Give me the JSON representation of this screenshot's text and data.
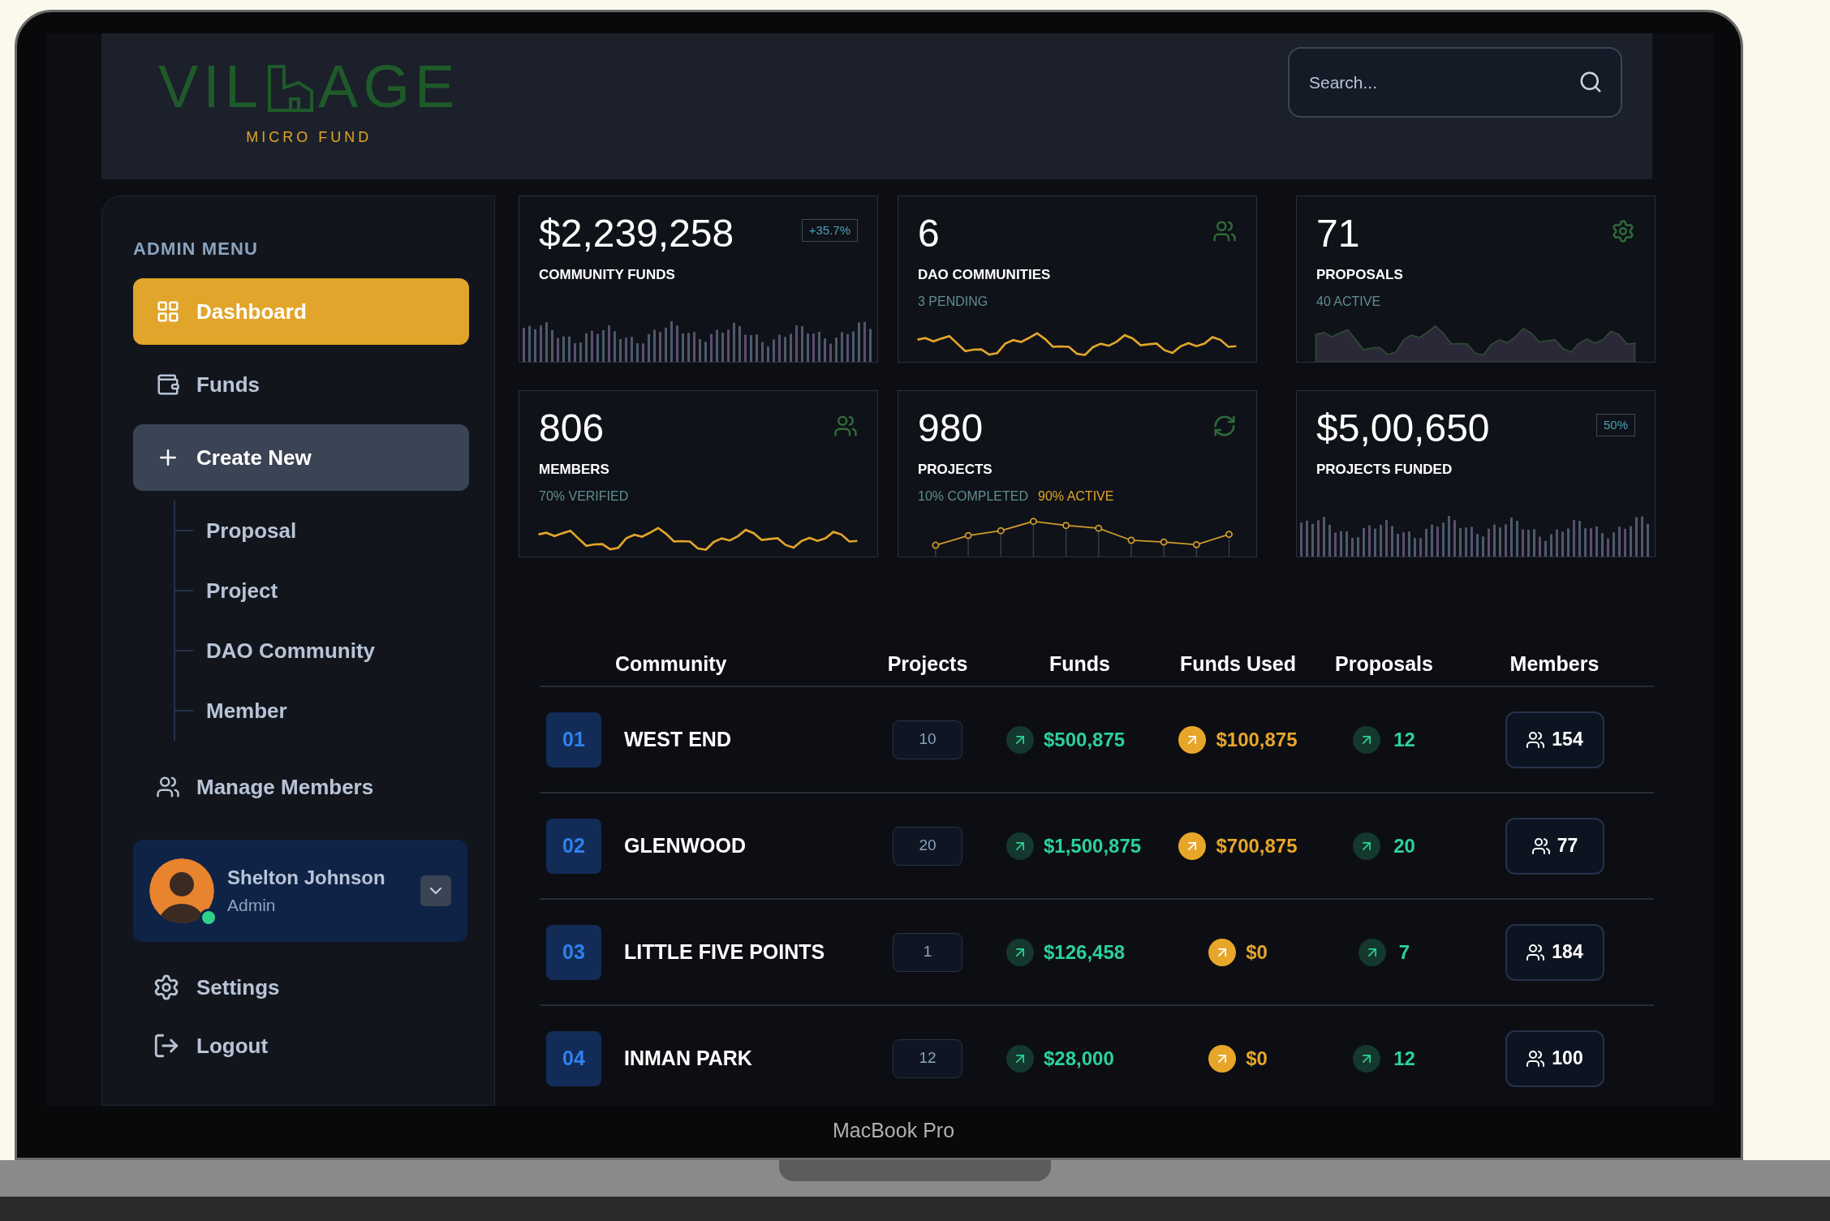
{
  "device_label": "MacBook Pro",
  "logo": {
    "wordmark_start": "VIL",
    "wordmark_end": "AGE",
    "tagline": "MICRO FUND"
  },
  "search": {
    "placeholder": "Search..."
  },
  "sidebar": {
    "heading": "ADMIN MENU",
    "items": [
      {
        "label": "Dashboard",
        "selected": true,
        "expanded": false
      },
      {
        "label": "Funds",
        "selected": false,
        "expanded": false
      },
      {
        "label": "Create New",
        "selected": false,
        "expanded": true,
        "children": [
          {
            "label": "Proposal"
          },
          {
            "label": "Project"
          },
          {
            "label": "DAO Community"
          },
          {
            "label": "Member"
          }
        ]
      },
      {
        "label": "Manage Members",
        "selected": false,
        "expanded": false
      }
    ],
    "user": {
      "name": "Shelton Johnson",
      "role": "Admin",
      "online": true
    },
    "footer_items": [
      {
        "label": "Settings"
      },
      {
        "label": "Logout"
      }
    ]
  },
  "cards": [
    {
      "kind": "bars",
      "value": "$2,239,258",
      "label": "COMMUNITY FUNDS",
      "badge": "+35.7%"
    },
    {
      "kind": "line",
      "value": "6",
      "label": "DAO COMMUNITIES",
      "notes": [
        {
          "text": "3 PENDING",
          "color": "#5f8e94"
        }
      ]
    },
    {
      "kind": "area",
      "value": "71",
      "label": "PROPOSALS",
      "notes": [
        {
          "text": "40 ACTIVE",
          "color": "#5f8e94"
        }
      ]
    },
    {
      "kind": "line",
      "value": "806",
      "label": "MEMBERS",
      "notes": [
        {
          "text": "70% VERIFIED",
          "color": "#5f8e94"
        }
      ]
    },
    {
      "kind": "dots",
      "value": "980",
      "label": "PROJECTS",
      "notes": [
        {
          "text": "10% COMPLETED",
          "color": "#5f8e94"
        },
        {
          "text": "90% ACTIVE",
          "color": "#e2a52b"
        }
      ]
    },
    {
      "kind": "bars",
      "value": "$5,00,650",
      "label": "PROJECTS FUNDED",
      "badge": "50%"
    }
  ],
  "table": {
    "columns": [
      "Community",
      "Projects",
      "Funds",
      "Funds Used",
      "Proposals",
      "Members"
    ],
    "rows": [
      {
        "index": "01",
        "community": "WEST END",
        "projects": "10",
        "funds": "$500,875",
        "funds_used": "$100,875",
        "proposals": "12",
        "members": "154"
      },
      {
        "index": "02",
        "community": "GLENWOOD",
        "projects": "20",
        "funds": "$1,500,875",
        "funds_used": "$700,875",
        "proposals": "20",
        "members": "77"
      },
      {
        "index": "03",
        "community": "LITTLE FIVE POINTS",
        "projects": "1",
        "funds": "$126,458",
        "funds_used": "$0",
        "proposals": "7",
        "members": "184"
      },
      {
        "index": "04",
        "community": "INMAN PARK",
        "projects": "12",
        "funds": "$28,000",
        "funds_used": "$0",
        "proposals": "12",
        "members": "100"
      }
    ]
  }
}
